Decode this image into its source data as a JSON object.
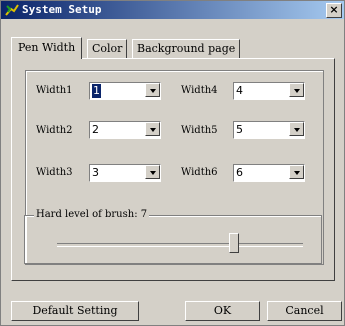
{
  "window": {
    "title": "System Setup",
    "close_label": "×"
  },
  "tabs": [
    {
      "label": "Pen Width",
      "active": true
    },
    {
      "label": "Color",
      "active": false
    },
    {
      "label": "Background page",
      "active": false
    }
  ],
  "widths": [
    {
      "label": "Width1",
      "value": "1"
    },
    {
      "label": "Width2",
      "value": "2"
    },
    {
      "label": "Width3",
      "value": "3"
    },
    {
      "label": "Width4",
      "value": "4"
    },
    {
      "label": "Width5",
      "value": "5"
    },
    {
      "label": "Width6",
      "value": "6"
    }
  ],
  "brush": {
    "label": "Hard level of brush: 7",
    "value": 7,
    "fraction": 0.73
  },
  "buttons": {
    "default": "Default Setting",
    "ok": "OK",
    "cancel": "Cancel"
  },
  "colors": {
    "title_start": "#0a246a",
    "title_end": "#a6caf0",
    "face": "#d4d0c8"
  }
}
